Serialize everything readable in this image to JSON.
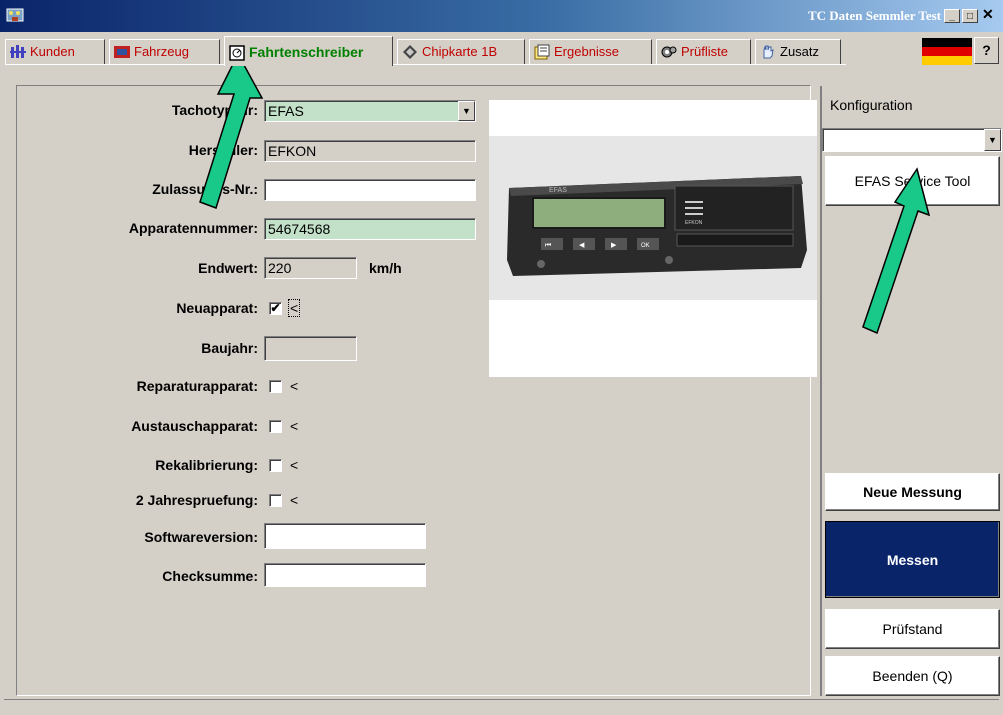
{
  "window": {
    "title": "TC Daten Semmler Test"
  },
  "tabs": [
    {
      "label": "Kunden",
      "color": "#c00000"
    },
    {
      "label": "Fahrzeug",
      "color": "#c00000"
    },
    {
      "label": "Fahrtenschreiber",
      "color": "#008000"
    },
    {
      "label": "Chipkarte 1B",
      "color": "#c00000"
    },
    {
      "label": "Ergebnisse",
      "color": "#c00000"
    },
    {
      "label": "Prüfliste",
      "color": "#c00000"
    },
    {
      "label": "Zusatz",
      "color": "#000000"
    }
  ],
  "help_label": "?",
  "form": {
    "tachotyp_label": "Tachotyp-Nr:",
    "tachotyp_value": "EFAS",
    "hersteller_label": "Hersteller:",
    "hersteller_value": "EFKON",
    "zulassung_label": "Zulassungs-Nr.:",
    "zulassung_value": "",
    "apparatennummer_label": "Apparatennummer:",
    "apparatennummer_value": "54674568",
    "endwert_label": "Endwert:",
    "endwert_value": "220",
    "endwert_unit": "km/h",
    "neuapparat_label": "Neuapparat:",
    "neuapparat_checked": "✔",
    "baujahr_label": "Baujahr:",
    "reparatur_label": "Reparaturapparat:",
    "austausch_label": "Austauschapparat:",
    "rekalibrierung_label": "Rekalibrierung:",
    "jahrespruefung_label": "2 Jahrespruefung:",
    "softwareversion_label": "Softwareversion:",
    "checksumme_label": "Checksumme:",
    "less_than": "<"
  },
  "device_image": {
    "brand_left": "EFAS",
    "brand_right": "EFKON",
    "keys": [
      "⏮",
      "◀",
      "▶",
      "OK"
    ]
  },
  "right": {
    "konfiguration_label": "Konfiguration",
    "konfiguration_value": "",
    "efas_button": "EFAS Service Tool",
    "neue_messung": "Neue Messung",
    "messen": "Messen",
    "pruefstand": "Prüfstand",
    "beenden": "Beenden (Q)"
  },
  "colors": {
    "accent_green": "#c3e1c8",
    "messen_bg": "#0a246a",
    "arrow": "#19c98a"
  }
}
